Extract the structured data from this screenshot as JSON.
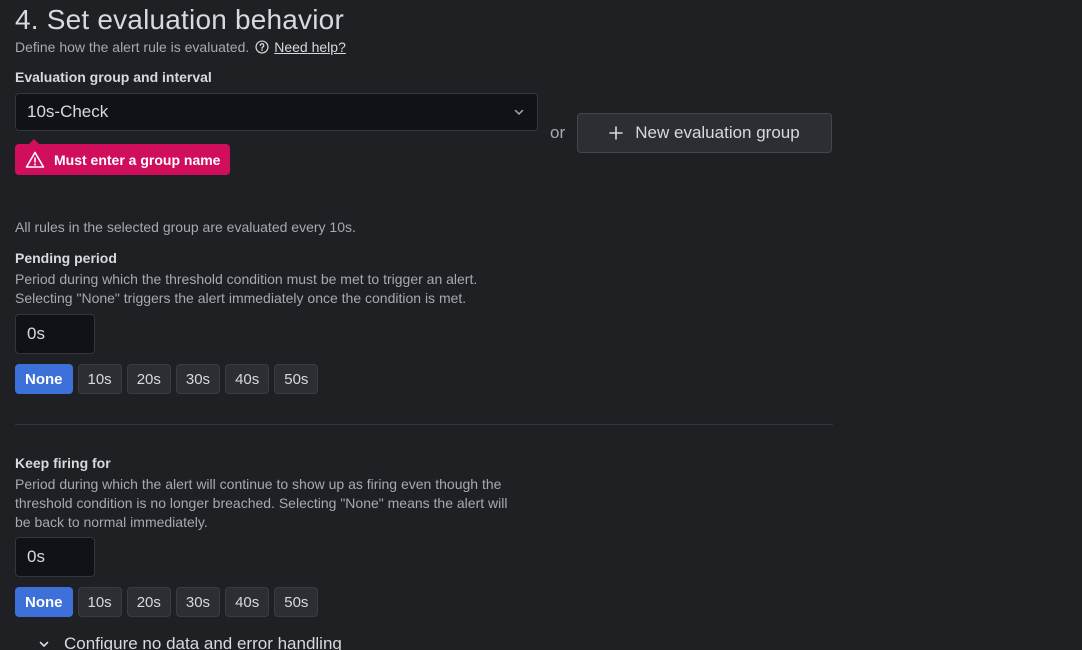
{
  "section": {
    "title": "4. Set evaluation behavior",
    "subtitle": "Define how the alert rule is evaluated.",
    "help_link": "Need help?"
  },
  "evaluation_group": {
    "label": "Evaluation group and interval",
    "selected": "10s-Check",
    "error": "Must enter a group name",
    "or_text": "or",
    "new_group_button": "New evaluation group",
    "info": "All rules in the selected group are evaluated every 10s."
  },
  "pending_period": {
    "label": "Pending period",
    "description": "Period during which the threshold condition must be met to trigger an alert.\nSelecting \"None\" triggers the alert immediately once the condition is met.",
    "value": "0s",
    "options": [
      "None",
      "10s",
      "20s",
      "30s",
      "40s",
      "50s"
    ],
    "active_option": "None"
  },
  "keep_firing": {
    "label": "Keep firing for",
    "description": "Period during which the alert will continue to show up as firing even though the\nthreshold condition is no longer breached. Selecting \"None\" means the alert will\nbe back to normal immediately.",
    "value": "0s",
    "options": [
      "None",
      "10s",
      "20s",
      "30s",
      "40s",
      "50s"
    ],
    "active_option": "None"
  },
  "no_data_section": {
    "label": "Configure no data and error handling"
  },
  "colors": {
    "background": "#1f2024",
    "error": "#d10e5c",
    "primary": "#3d71d9"
  }
}
